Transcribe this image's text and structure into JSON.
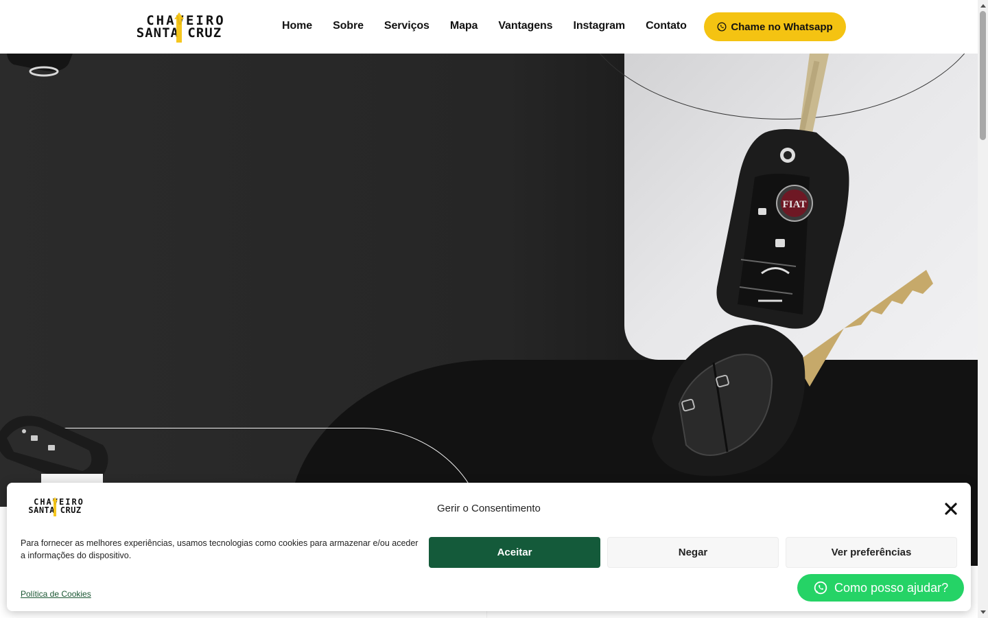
{
  "brand": {
    "line1": "CHAVEIRO",
    "line2": "SANTA CRUZ",
    "accent": "#f4c312"
  },
  "nav": {
    "items": [
      {
        "label": "Home"
      },
      {
        "label": "Sobre"
      },
      {
        "label": "Serviços"
      },
      {
        "label": "Mapa"
      },
      {
        "label": "Vantagens"
      },
      {
        "label": "Instagram"
      },
      {
        "label": "Contato"
      }
    ]
  },
  "header": {
    "whatsapp_label": "Chame no Whatsapp",
    "whatsapp_icon": "whatsapp-icon"
  },
  "hero": {
    "product_badge": "FIAT"
  },
  "cookie": {
    "title": "Gerir o Consentimento",
    "text": "Para fornecer as melhores experiências, usamos tecnologias como cookies para armazenar e/ou aceder a informações do dispositivo.",
    "accept": "Aceitar",
    "deny": "Negar",
    "preferences": "Ver preferências",
    "policy_link": "Política de Cookies",
    "accent": "#145a3a"
  },
  "chat": {
    "label": "Como posso ajudar?",
    "color": "#25d366"
  }
}
